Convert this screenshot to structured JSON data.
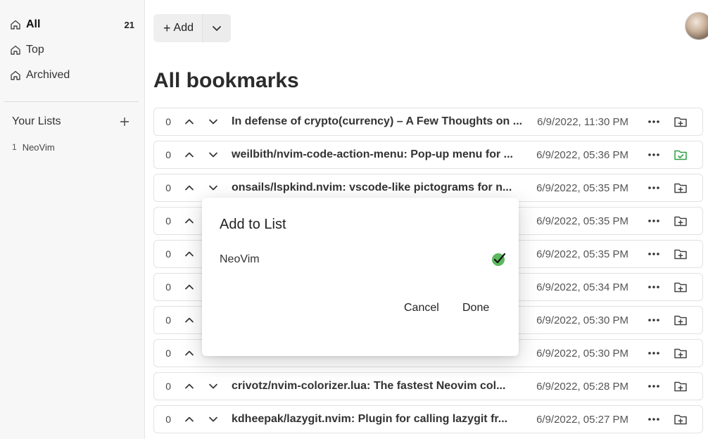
{
  "sidebar": {
    "nav": [
      {
        "label": "All",
        "count": "21",
        "icon": "home-icon"
      },
      {
        "label": "Top",
        "icon": "home-icon"
      },
      {
        "label": "Archived",
        "icon": "home-icon"
      }
    ],
    "lists_title": "Your Lists",
    "lists": [
      {
        "num": "1",
        "label": "NeoVim"
      }
    ]
  },
  "toolbar": {
    "add_label": "Add"
  },
  "page_title": "All bookmarks",
  "bookmarks": [
    {
      "score": "0",
      "title": "In defense of crypto(currency) – A Few Thoughts on ...",
      "date": "6/9/2022, 11:30 PM"
    },
    {
      "score": "0",
      "title": "weilbith/nvim-code-action-menu: Pop-up menu for ...",
      "date": "6/9/2022, 05:36 PM"
    },
    {
      "score": "0",
      "title": "onsails/lspkind.nvim: vscode-like pictograms for n...",
      "date": "6/9/2022, 05:35 PM"
    },
    {
      "score": "0",
      "title": "",
      "date": "6/9/2022, 05:35 PM"
    },
    {
      "score": "0",
      "title": "",
      "date": "6/9/2022, 05:35 PM"
    },
    {
      "score": "0",
      "title": "",
      "date": "6/9/2022, 05:34 PM"
    },
    {
      "score": "0",
      "title": "",
      "date": "6/9/2022, 05:30 PM"
    },
    {
      "score": "0",
      "title": "",
      "date": "6/9/2022, 05:30 PM"
    },
    {
      "score": "0",
      "title": "crivotz/nvim-colorizer.lua: The fastest Neovim col...",
      "date": "6/9/2022, 05:28 PM"
    },
    {
      "score": "0",
      "title": "kdheepak/lazygit.nvim: Plugin for calling lazygit fr...",
      "date": "6/9/2022, 05:27 PM"
    }
  ],
  "modal": {
    "title": "Add to List",
    "list_name": "NeoVim",
    "cancel": "Cancel",
    "done": "Done"
  },
  "colors": {
    "accent_green": "#2f9e44",
    "check_bg": "#5cb85c"
  }
}
